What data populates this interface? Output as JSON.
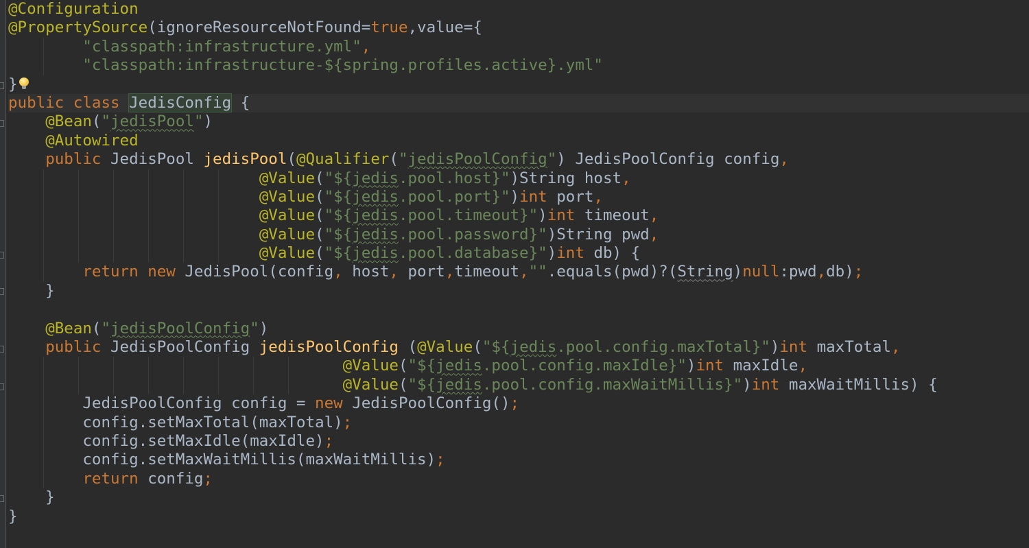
{
  "editor": {
    "lines": [
      [
        {
          "t": "@Configuration",
          "c": "ann"
        }
      ],
      [
        {
          "t": "@PropertySource",
          "c": "ann"
        },
        {
          "t": "(ignoreResourceNotFound=",
          "c": "plain"
        },
        {
          "t": "true",
          "c": "kw"
        },
        {
          "t": ",value={",
          "c": "plain"
        }
      ],
      [
        {
          "t": "        ",
          "c": "plain"
        },
        {
          "t": "\"classpath:infrastructure.yml\"",
          "c": "str"
        },
        {
          "t": ",",
          "c": "kw"
        }
      ],
      [
        {
          "t": "        ",
          "c": "plain"
        },
        {
          "t": "\"classpath:infrastructure-${spring.profiles.active}.yml\"",
          "c": "str"
        }
      ],
      [
        {
          "t": "}",
          "c": "plain"
        },
        {
          "icon": "lightbulb-icon"
        }
      ],
      [
        {
          "t": "public class ",
          "c": "kw"
        },
        {
          "t": "JedisConfig",
          "c": "plain hl"
        },
        {
          "t": " {",
          "c": "plain"
        }
      ],
      [
        {
          "t": "    ",
          "c": "plain"
        },
        {
          "t": "@Bean",
          "c": "ann"
        },
        {
          "t": "(",
          "c": "plain"
        },
        {
          "t": "\"",
          "c": "str"
        },
        {
          "t": "jedisPool",
          "c": "str wavy"
        },
        {
          "t": "\"",
          "c": "str"
        },
        {
          "t": ")",
          "c": "plain"
        }
      ],
      [
        {
          "t": "    ",
          "c": "plain"
        },
        {
          "t": "@Autowired",
          "c": "ann"
        }
      ],
      [
        {
          "t": "    ",
          "c": "plain"
        },
        {
          "t": "public ",
          "c": "kw"
        },
        {
          "t": "JedisPool ",
          "c": "plain"
        },
        {
          "t": "jedisPool",
          "c": "fn"
        },
        {
          "t": "(",
          "c": "plain"
        },
        {
          "t": "@Qualifier",
          "c": "ann"
        },
        {
          "t": "(",
          "c": "plain"
        },
        {
          "t": "\"",
          "c": "str"
        },
        {
          "t": "jedisPoolConfig",
          "c": "str wavy"
        },
        {
          "t": "\"",
          "c": "str"
        },
        {
          "t": ") JedisPoolConfig config",
          "c": "plain"
        },
        {
          "t": ",",
          "c": "kw"
        }
      ],
      [
        {
          "t": "                           ",
          "c": "plain"
        },
        {
          "t": "@Value",
          "c": "ann"
        },
        {
          "t": "(",
          "c": "plain"
        },
        {
          "t": "\"${",
          "c": "str"
        },
        {
          "t": "jedis",
          "c": "str wavy"
        },
        {
          "t": ".pool.host}\"",
          "c": "str"
        },
        {
          "t": ")String host",
          "c": "plain"
        },
        {
          "t": ",",
          "c": "kw"
        }
      ],
      [
        {
          "t": "                           ",
          "c": "plain"
        },
        {
          "t": "@Value",
          "c": "ann"
        },
        {
          "t": "(",
          "c": "plain"
        },
        {
          "t": "\"${",
          "c": "str"
        },
        {
          "t": "jedis",
          "c": "str wavy"
        },
        {
          "t": ".pool.port}\"",
          "c": "str"
        },
        {
          "t": ")",
          "c": "plain"
        },
        {
          "t": "int ",
          "c": "kw"
        },
        {
          "t": "port",
          "c": "plain"
        },
        {
          "t": ",",
          "c": "kw"
        }
      ],
      [
        {
          "t": "                           ",
          "c": "plain"
        },
        {
          "t": "@Value",
          "c": "ann"
        },
        {
          "t": "(",
          "c": "plain"
        },
        {
          "t": "\"${",
          "c": "str"
        },
        {
          "t": "jedis",
          "c": "str wavy"
        },
        {
          "t": ".pool.timeout}\"",
          "c": "str"
        },
        {
          "t": ")",
          "c": "plain"
        },
        {
          "t": "int ",
          "c": "kw"
        },
        {
          "t": "timeout",
          "c": "plain"
        },
        {
          "t": ",",
          "c": "kw"
        }
      ],
      [
        {
          "t": "                           ",
          "c": "plain"
        },
        {
          "t": "@Value",
          "c": "ann"
        },
        {
          "t": "(",
          "c": "plain"
        },
        {
          "t": "\"${",
          "c": "str"
        },
        {
          "t": "jedis",
          "c": "str wavy"
        },
        {
          "t": ".pool.password}\"",
          "c": "str"
        },
        {
          "t": ")String pwd",
          "c": "plain"
        },
        {
          "t": ",",
          "c": "kw"
        }
      ],
      [
        {
          "t": "                           ",
          "c": "plain"
        },
        {
          "t": "@Value",
          "c": "ann"
        },
        {
          "t": "(",
          "c": "plain"
        },
        {
          "t": "\"${",
          "c": "str"
        },
        {
          "t": "jedis",
          "c": "str wavy"
        },
        {
          "t": ".pool.database}\"",
          "c": "str"
        },
        {
          "t": ")",
          "c": "plain"
        },
        {
          "t": "int ",
          "c": "kw"
        },
        {
          "t": "db) {",
          "c": "plain"
        }
      ],
      [
        {
          "t": "        ",
          "c": "plain"
        },
        {
          "t": "return new ",
          "c": "kw"
        },
        {
          "t": "JedisPool(config",
          "c": "plain"
        },
        {
          "t": ", ",
          "c": "kw"
        },
        {
          "t": "host",
          "c": "plain"
        },
        {
          "t": ", ",
          "c": "kw"
        },
        {
          "t": "port",
          "c": "plain"
        },
        {
          "t": ",",
          "c": "kw"
        },
        {
          "t": "timeout",
          "c": "plain"
        },
        {
          "t": ",",
          "c": "kw"
        },
        {
          "t": "\"\"",
          "c": "str"
        },
        {
          "t": ".equals(pwd)?(",
          "c": "plain"
        },
        {
          "t": "String",
          "c": "plain wavy-grey"
        },
        {
          "t": ")",
          "c": "plain"
        },
        {
          "t": "null",
          "c": "kw"
        },
        {
          "t": ":pwd",
          "c": "plain"
        },
        {
          "t": ",",
          "c": "kw"
        },
        {
          "t": "db)",
          "c": "plain"
        },
        {
          "t": ";",
          "c": "kw"
        }
      ],
      [
        {
          "t": "    }",
          "c": "plain"
        }
      ],
      [
        {
          "t": "",
          "c": "plain"
        }
      ],
      [
        {
          "t": "    ",
          "c": "plain"
        },
        {
          "t": "@Bean",
          "c": "ann"
        },
        {
          "t": "(",
          "c": "plain"
        },
        {
          "t": "\"",
          "c": "str"
        },
        {
          "t": "jedisPoolConfig",
          "c": "str wavy"
        },
        {
          "t": "\"",
          "c": "str"
        },
        {
          "t": ")",
          "c": "plain"
        }
      ],
      [
        {
          "t": "    ",
          "c": "plain"
        },
        {
          "t": "public ",
          "c": "kw"
        },
        {
          "t": "JedisPoolConfig ",
          "c": "plain"
        },
        {
          "t": "jedisPoolConfig",
          "c": "fn"
        },
        {
          "t": " (",
          "c": "plain"
        },
        {
          "t": "@Value",
          "c": "ann"
        },
        {
          "t": "(",
          "c": "plain"
        },
        {
          "t": "\"${",
          "c": "str"
        },
        {
          "t": "jedis",
          "c": "str wavy"
        },
        {
          "t": ".pool.config.maxTotal}\"",
          "c": "str"
        },
        {
          "t": ")",
          "c": "plain"
        },
        {
          "t": "int ",
          "c": "kw"
        },
        {
          "t": "maxTotal",
          "c": "plain"
        },
        {
          "t": ",",
          "c": "kw"
        }
      ],
      [
        {
          "t": "                                    ",
          "c": "plain"
        },
        {
          "t": "@Value",
          "c": "ann"
        },
        {
          "t": "(",
          "c": "plain"
        },
        {
          "t": "\"${",
          "c": "str"
        },
        {
          "t": "jedis",
          "c": "str wavy"
        },
        {
          "t": ".pool.config.maxIdle}\"",
          "c": "str"
        },
        {
          "t": ")",
          "c": "plain"
        },
        {
          "t": "int ",
          "c": "kw"
        },
        {
          "t": "maxIdle",
          "c": "plain"
        },
        {
          "t": ",",
          "c": "kw"
        }
      ],
      [
        {
          "t": "                                    ",
          "c": "plain"
        },
        {
          "t": "@Value",
          "c": "ann"
        },
        {
          "t": "(",
          "c": "plain"
        },
        {
          "t": "\"${",
          "c": "str"
        },
        {
          "t": "jedis",
          "c": "str wavy"
        },
        {
          "t": ".pool.config.maxWaitMillis}\"",
          "c": "str"
        },
        {
          "t": ")",
          "c": "plain"
        },
        {
          "t": "int ",
          "c": "kw"
        },
        {
          "t": "maxWaitMillis) {",
          "c": "plain"
        }
      ],
      [
        {
          "t": "        ",
          "c": "plain"
        },
        {
          "t": "JedisPoolConfig config = ",
          "c": "plain"
        },
        {
          "t": "new ",
          "c": "kw"
        },
        {
          "t": "JedisPoolConfig()",
          "c": "plain"
        },
        {
          "t": ";",
          "c": "kw"
        }
      ],
      [
        {
          "t": "        ",
          "c": "plain"
        },
        {
          "t": "config.setMaxTotal(maxTotal)",
          "c": "plain"
        },
        {
          "t": ";",
          "c": "kw"
        }
      ],
      [
        {
          "t": "        ",
          "c": "plain"
        },
        {
          "t": "config.setMaxIdle(maxIdle)",
          "c": "plain"
        },
        {
          "t": ";",
          "c": "kw"
        }
      ],
      [
        {
          "t": "        ",
          "c": "plain"
        },
        {
          "t": "config.setMaxWaitMillis(maxWaitMillis)",
          "c": "plain"
        },
        {
          "t": ";",
          "c": "kw"
        }
      ],
      [
        {
          "t": "        ",
          "c": "plain"
        },
        {
          "t": "return ",
          "c": "kw"
        },
        {
          "t": "config",
          "c": "plain"
        },
        {
          "t": ";",
          "c": "kw"
        }
      ],
      [
        {
          "t": "    }",
          "c": "plain"
        }
      ],
      [
        {
          "t": "}",
          "c": "plain"
        }
      ]
    ],
    "current_line": 5,
    "colors": {
      "background": "#2b2b2b",
      "annotation": "#bbb529",
      "keyword": "#cc7832",
      "string": "#6a8759",
      "method": "#ffc66d",
      "text": "#a9b7c6"
    }
  }
}
